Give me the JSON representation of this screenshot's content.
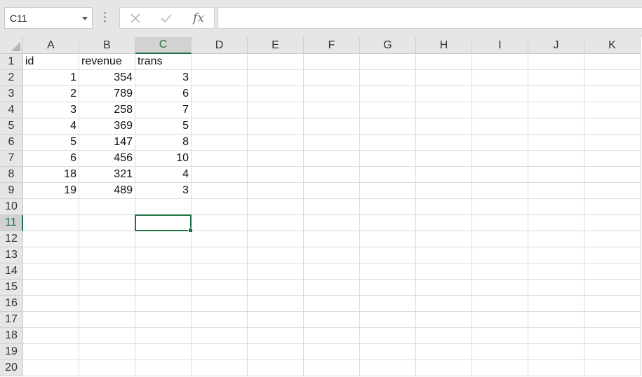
{
  "formula_bar": {
    "name_box": "C11",
    "cancel_icon": "close-icon",
    "enter_icon": "check-icon",
    "fx_label": "fx",
    "formula_value": ""
  },
  "sheet": {
    "columns": [
      "A",
      "B",
      "C",
      "D",
      "E",
      "F",
      "G",
      "H",
      "I",
      "J",
      "K"
    ],
    "rows": [
      "1",
      "2",
      "3",
      "4",
      "5",
      "6",
      "7",
      "8",
      "9",
      "10",
      "11",
      "12",
      "13",
      "14",
      "15",
      "16",
      "17",
      "18",
      "19",
      "20"
    ],
    "active_column": "C",
    "active_row": "11",
    "selected_cell": "C11",
    "cells": [
      [
        "id",
        "revenue",
        "trans"
      ],
      [
        "1",
        "354",
        "3"
      ],
      [
        "2",
        "789",
        "6"
      ],
      [
        "3",
        "258",
        "7"
      ],
      [
        "4",
        "369",
        "5"
      ],
      [
        "5",
        "147",
        "8"
      ],
      [
        "6",
        "456",
        "10"
      ],
      [
        "18",
        "321",
        "4"
      ],
      [
        "19",
        "489",
        "3"
      ]
    ]
  },
  "colors": {
    "accent": "#217346",
    "header_bg": "#e6e6e6",
    "gridline": "#dcdcdc"
  }
}
